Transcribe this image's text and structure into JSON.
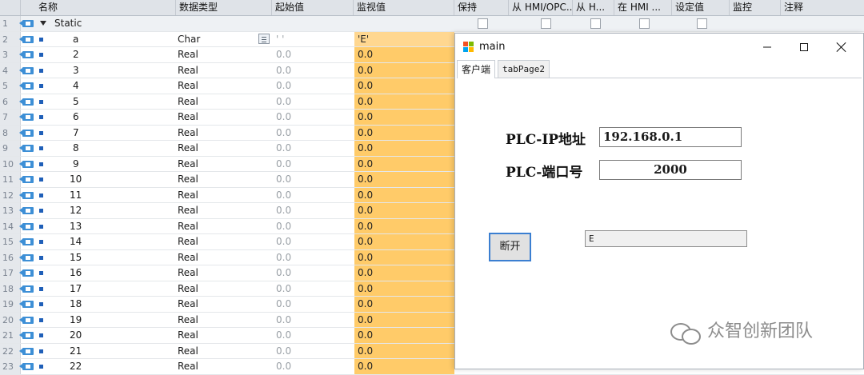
{
  "table": {
    "columns": [
      "名称",
      "数据类型",
      "起始值",
      "监视值",
      "保持",
      "从 HMI/OPC...",
      "从 H...",
      "在 HMI ...",
      "设定值",
      "监控",
      "注释"
    ],
    "static_row": {
      "num": "1",
      "name": "Static"
    },
    "rows": [
      {
        "num": "2",
        "name": "a",
        "type": "Char",
        "start": "' '",
        "monitor": "'E'"
      },
      {
        "num": "3",
        "name": "2",
        "type": "Real",
        "start": "0.0",
        "monitor": "0.0"
      },
      {
        "num": "4",
        "name": "3",
        "type": "Real",
        "start": "0.0",
        "monitor": "0.0"
      },
      {
        "num": "5",
        "name": "4",
        "type": "Real",
        "start": "0.0",
        "monitor": "0.0"
      },
      {
        "num": "6",
        "name": "5",
        "type": "Real",
        "start": "0.0",
        "monitor": "0.0"
      },
      {
        "num": "7",
        "name": "6",
        "type": "Real",
        "start": "0.0",
        "monitor": "0.0"
      },
      {
        "num": "8",
        "name": "7",
        "type": "Real",
        "start": "0.0",
        "monitor": "0.0"
      },
      {
        "num": "9",
        "name": "8",
        "type": "Real",
        "start": "0.0",
        "monitor": "0.0"
      },
      {
        "num": "10",
        "name": "9",
        "type": "Real",
        "start": "0.0",
        "monitor": "0.0"
      },
      {
        "num": "11",
        "name": "10",
        "type": "Real",
        "start": "0.0",
        "monitor": "0.0"
      },
      {
        "num": "12",
        "name": "11",
        "type": "Real",
        "start": "0.0",
        "monitor": "0.0"
      },
      {
        "num": "13",
        "name": "12",
        "type": "Real",
        "start": "0.0",
        "monitor": "0.0"
      },
      {
        "num": "14",
        "name": "13",
        "type": "Real",
        "start": "0.0",
        "monitor": "0.0"
      },
      {
        "num": "15",
        "name": "14",
        "type": "Real",
        "start": "0.0",
        "monitor": "0.0"
      },
      {
        "num": "16",
        "name": "15",
        "type": "Real",
        "start": "0.0",
        "monitor": "0.0"
      },
      {
        "num": "17",
        "name": "16",
        "type": "Real",
        "start": "0.0",
        "monitor": "0.0"
      },
      {
        "num": "18",
        "name": "17",
        "type": "Real",
        "start": "0.0",
        "monitor": "0.0"
      },
      {
        "num": "19",
        "name": "18",
        "type": "Real",
        "start": "0.0",
        "monitor": "0.0"
      },
      {
        "num": "20",
        "name": "19",
        "type": "Real",
        "start": "0.0",
        "monitor": "0.0"
      },
      {
        "num": "21",
        "name": "20",
        "type": "Real",
        "start": "0.0",
        "monitor": "0.0"
      },
      {
        "num": "22",
        "name": "21",
        "type": "Real",
        "start": "0.0",
        "monitor": "0.0"
      },
      {
        "num": "23",
        "name": "22",
        "type": "Real",
        "start": "0.0",
        "monitor": "0.0"
      }
    ],
    "monitor_color": "#ffcb69"
  },
  "window": {
    "title": "main",
    "tabs": [
      "客户端",
      "tabPage2"
    ],
    "ip_label": "PLC-IP地址",
    "ip_value": "192.168.0.1",
    "port_label": "PLC-端口号",
    "port_value": "2000",
    "disconnect_label": "断开",
    "received_value": "E",
    "accent_color": "#3b7fd1"
  },
  "watermark": {
    "text": "众智创新团队"
  }
}
